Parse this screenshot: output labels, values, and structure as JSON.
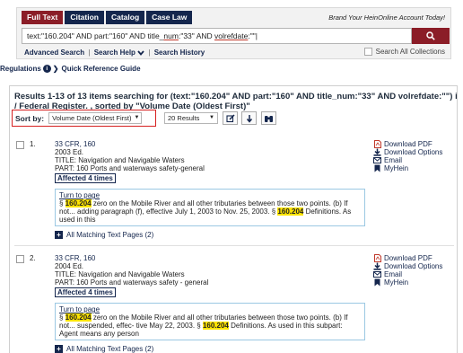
{
  "tabs": [
    "Full Text",
    "Citation",
    "Catalog",
    "Case Law"
  ],
  "brand_text": "Brand Your HeinOnline Account Today!",
  "search": {
    "query_parts": [
      "text:\"160.204\" AND part:\"160\" AND title_",
      "num",
      ":\"33\" AND ",
      "volrefdate",
      ":\"\"|"
    ]
  },
  "links": {
    "advanced": "Advanced Search",
    "help": "Search Help",
    "history": "Search History",
    "sep": "|"
  },
  "all_collections": "Search All Collections",
  "regulations_bar": {
    "label": "Regulations",
    "guide": "Quick Reference Guide"
  },
  "results": {
    "header_line1": "Results 1-13 of 13 items searching for (text:\"160.204\" AND part:\"160\" AND title_num:\"33\" AND volrefdate:\"\") in Code",
    "header_line2": "/ Federal Register. , sorted by \"Volume Date (Oldest First)\"",
    "sort_label": "Sort by:",
    "sort_value": "Volume Date (Oldest First)",
    "per_page": "20 Results",
    "items": [
      {
        "number": "1.",
        "citation": "33 CFR, 160",
        "edition": "2003 Ed.",
        "title": "TITLE: Navigation and Navigable Waters",
        "part": "PART: 160 Ports and waterways safety-general",
        "affected": "Affected 4 times",
        "turn_to_page": "Turn to page",
        "snip_pre": "§ ",
        "snip_hl1": "160.204",
        "snip_mid": " zero on the Mobile River and all other tributaries between those two points. (b) If not... adding paragraph (f), effective July 1, 2003 to Nov. 25, 2003. § ",
        "snip_hl2": "160.204",
        "snip_post": " Definitions. As used in this",
        "all_matching": "All Matching Text Pages (2)"
      },
      {
        "number": "2.",
        "citation": "33 CFR, 160",
        "edition": "2004 Ed.",
        "title": "TITLE: Navigation and Navigable Waters",
        "part": "PART: 160 Ports and waterways safety - general",
        "affected": "Affected 4 times",
        "turn_to_page": "Turn to page",
        "snip_pre": "§ ",
        "snip_hl1": "160.204",
        "snip_mid": " zero on the Mobile River and all other tributaries between those two points. (b) If not... suspended, effec- tive May 22, 2003. § ",
        "snip_hl2": "160.204",
        "snip_post": " Definitions. As used in this subpart: Agent means any person",
        "all_matching": "All Matching Text Pages (2)"
      }
    ],
    "actions": {
      "download_pdf": "Download PDF",
      "download_options": "Download Options",
      "email": "Email",
      "myhein": "MyHein"
    }
  },
  "colors": {
    "navy": "#14264d",
    "maroon": "#8b1d27",
    "pdf_red": "#c0392b",
    "highlight": "#ffe400",
    "sort_border": "#d62020"
  }
}
